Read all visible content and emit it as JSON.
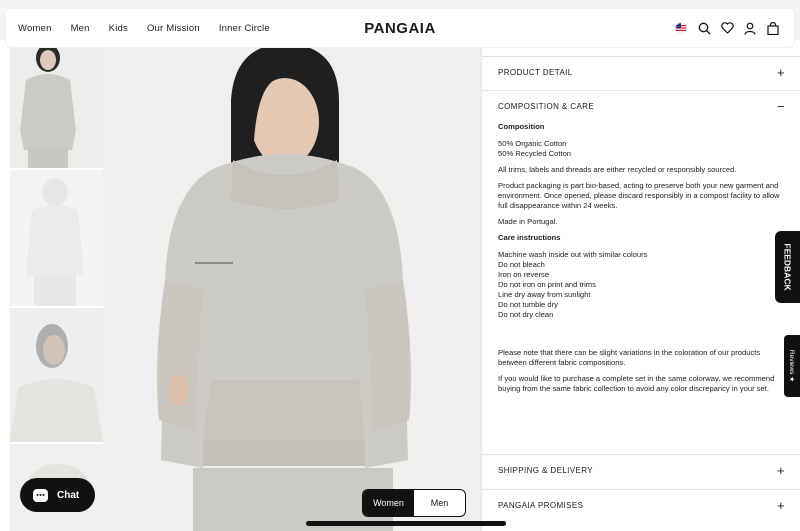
{
  "nav": {
    "links": [
      "Women",
      "Men",
      "Kids",
      "Our Mission",
      "Inner Circle"
    ],
    "logo": "PANGAIA"
  },
  "icons": [
    "us-flag-icon",
    "search-icon",
    "heart-icon",
    "user-icon",
    "bag-icon"
  ],
  "panel": {
    "sections": [
      {
        "label": "PRODUCT DETAIL",
        "state": "+"
      },
      {
        "label": "COMPOSITION & CARE",
        "state": "−"
      },
      {
        "label": "SHIPPING & DELIVERY",
        "state": "+"
      },
      {
        "label": "PANGAIA PROMISES",
        "state": "+"
      }
    ],
    "composition_heading": "Composition",
    "composition": [
      "50% Organic Cotton",
      "50% Recycled Cotton"
    ],
    "trims": "All trims, labels and threads are either recycled or responsibly sourced.",
    "packaging": "Product packaging is part bio-based, acting to preserve both your new garment and environment. Once opened, please discard responsibly in a compost facility to allow full disappearance within 24 weeks.",
    "origin": "Made in Portugal.",
    "care_heading": "Care instructions",
    "care": [
      "Machine wash inside out with similar colours",
      "Do not bleach",
      "Iron on reverse",
      "Do not iron on print and trims",
      "Line dry away from sunlight",
      "Do not tumble dry",
      "Do not dry clean"
    ],
    "variation_note": "Please note that there can be slight variations in the coloration of our products between different fabric compositions.",
    "set_note": "If you would like to purchase a complete set in the same colorway, we recommend buying from the same fabric collection to avoid any color discrepancy in your set."
  },
  "chat_label": "Chat",
  "toggle": {
    "women": "Women",
    "men": "Men"
  },
  "feedback_label": "FEEDBACK",
  "reviews_label": "Reviews ★",
  "colors": {
    "hoodie": "#cdcbc5",
    "background": "#efefef",
    "dark": "#111111"
  }
}
